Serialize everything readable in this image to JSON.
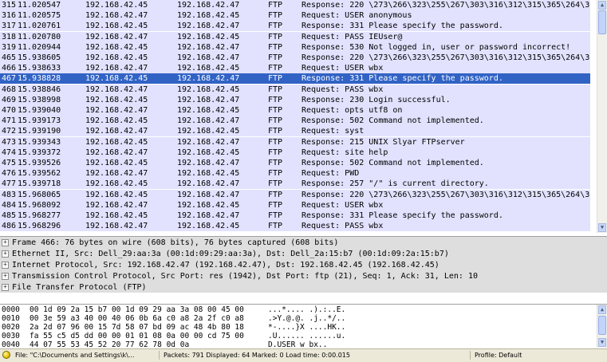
{
  "packet_list": {
    "selected_index": 7,
    "rows": [
      {
        "no": "315",
        "time": "11.020547",
        "src": "192.168.42.45",
        "dst": "192.168.42.47",
        "proto": "FTP",
        "info": "Response: 220 \\273\\266\\323\\255\\267\\303\\316\\312\\315\\365\\264\\363"
      },
      {
        "no": "316",
        "time": "11.020575",
        "src": "192.168.42.47",
        "dst": "192.168.42.45",
        "proto": "FTP",
        "info": "Request: USER anonymous"
      },
      {
        "no": "317",
        "time": "11.020761",
        "src": "192.168.42.45",
        "dst": "192.168.42.47",
        "proto": "FTP",
        "info": "Response: 331 Please specify the password."
      },
      {
        "no": "318",
        "time": "11.020780",
        "src": "192.168.42.47",
        "dst": "192.168.42.45",
        "proto": "FTP",
        "info": "Request: PASS IEUser@"
      },
      {
        "no": "319",
        "time": "11.020944",
        "src": "192.168.42.45",
        "dst": "192.168.42.47",
        "proto": "FTP",
        "info": "Response: 530 Not logged in, user or password incorrect!"
      },
      {
        "no": "465",
        "time": "15.938605",
        "src": "192.168.42.45",
        "dst": "192.168.42.47",
        "proto": "FTP",
        "info": "Response: 220 \\273\\266\\323\\255\\267\\303\\316\\312\\315\\365\\264\\363"
      },
      {
        "no": "466",
        "time": "15.938633",
        "src": "192.168.42.47",
        "dst": "192.168.42.45",
        "proto": "FTP",
        "info": "Request: USER wbx"
      },
      {
        "no": "467",
        "time": "15.938828",
        "src": "192.168.42.45",
        "dst": "192.168.42.47",
        "proto": "FTP",
        "info": "Response: 331 Please specify the password."
      },
      {
        "no": "468",
        "time": "15.938846",
        "src": "192.168.42.47",
        "dst": "192.168.42.45",
        "proto": "FTP",
        "info": "Request: PASS wbx"
      },
      {
        "no": "469",
        "time": "15.938998",
        "src": "192.168.42.45",
        "dst": "192.168.42.47",
        "proto": "FTP",
        "info": "Response: 230 Login successful."
      },
      {
        "no": "470",
        "time": "15.939040",
        "src": "192.168.42.47",
        "dst": "192.168.42.45",
        "proto": "FTP",
        "info": "Request: opts utf8 on"
      },
      {
        "no": "471",
        "time": "15.939173",
        "src": "192.168.42.45",
        "dst": "192.168.42.47",
        "proto": "FTP",
        "info": "Response: 502 Command not implemented."
      },
      {
        "no": "472",
        "time": "15.939190",
        "src": "192.168.42.47",
        "dst": "192.168.42.45",
        "proto": "FTP",
        "info": "Request: syst"
      },
      {
        "no": "473",
        "time": "15.939343",
        "src": "192.168.42.45",
        "dst": "192.168.42.47",
        "proto": "FTP",
        "info": "Response: 215 UNIX Slyar FTPserver"
      },
      {
        "no": "474",
        "time": "15.939372",
        "src": "192.168.42.47",
        "dst": "192.168.42.45",
        "proto": "FTP",
        "info": "Request: site help"
      },
      {
        "no": "475",
        "time": "15.939526",
        "src": "192.168.42.45",
        "dst": "192.168.42.47",
        "proto": "FTP",
        "info": "Response: 502 Command not implemented."
      },
      {
        "no": "476",
        "time": "15.939562",
        "src": "192.168.42.47",
        "dst": "192.168.42.45",
        "proto": "FTP",
        "info": "Request: PWD"
      },
      {
        "no": "477",
        "time": "15.939718",
        "src": "192.168.42.45",
        "dst": "192.168.42.47",
        "proto": "FTP",
        "info": "Response: 257 \"/\" is current directory."
      },
      {
        "no": "483",
        "time": "15.968065",
        "src": "192.168.42.45",
        "dst": "192.168.42.47",
        "proto": "FTP",
        "info": "Response: 220 \\273\\266\\323\\255\\267\\303\\316\\312\\315\\365\\264\\363"
      },
      {
        "no": "484",
        "time": "15.968092",
        "src": "192.168.42.47",
        "dst": "192.168.42.45",
        "proto": "FTP",
        "info": "Request: USER wbx"
      },
      {
        "no": "485",
        "time": "15.968277",
        "src": "192.168.42.45",
        "dst": "192.168.42.47",
        "proto": "FTP",
        "info": "Response: 331 Please specify the password."
      },
      {
        "no": "486",
        "time": "15.968296",
        "src": "192.168.42.47",
        "dst": "192.168.42.45",
        "proto": "FTP",
        "info": "Request: PASS wbx"
      }
    ]
  },
  "details": {
    "rows": [
      {
        "expander": "+",
        "text": "Frame 466: 76 bytes on wire (608 bits), 76 bytes captured (608 bits)"
      },
      {
        "expander": "+",
        "text": "Ethernet II, Src: Dell_29:aa:3a (00:1d:09:29:aa:3a), Dst: Dell_2a:15:b7 (00:1d:09:2a:15:b7)"
      },
      {
        "expander": "+",
        "text": "Internet Protocol, Src: 192.168.42.47 (192.168.42.47), Dst: 192.168.42.45 (192.168.42.45)"
      },
      {
        "expander": "+",
        "text": "Transmission Control Protocol, Src Port: res (1942), Dst Port: ftp (21), Seq: 1, Ack: 31, Len: 10"
      },
      {
        "expander": "+",
        "text": "File Transfer Protocol (FTP)"
      }
    ]
  },
  "hex": {
    "rows": [
      {
        "offset": "0000",
        "hex": "00 1d 09 2a 15 b7 00 1d  09 29 aa 3a 08 00 45 00",
        "ascii": "...*.... .).:..E."
      },
      {
        "offset": "0010",
        "hex": "00 3e 59 a3 40 00 40 06  0b 6a c0 a8 2a 2f c0 a8",
        "ascii": ".>Y.@.@. .j..*/.."
      },
      {
        "offset": "0020",
        "hex": "2a 2d 07 96 00 15 7d 58  07 bd 09 ac 48 4b 80 18",
        "ascii": "*-....}X ....HK.."
      },
      {
        "offset": "0030",
        "hex": "fa 55 c5 d5 dd 00 00 01  01 08 0a 00 00 cd 75 00",
        "ascii": ".U...... ......u."
      },
      {
        "offset": "0040",
        "hex": "44 07 55 53 45 52 20 77  62 78 0d 0a",
        "ascii": "D.USER w bx.."
      }
    ]
  },
  "status": {
    "file": "File: \"C:\\Documents and Settings\\k\\...",
    "packets": "Packets: 791 Displayed: 64 Marked: 0 Load time: 0:00.015",
    "profile": "Profile: Default"
  }
}
